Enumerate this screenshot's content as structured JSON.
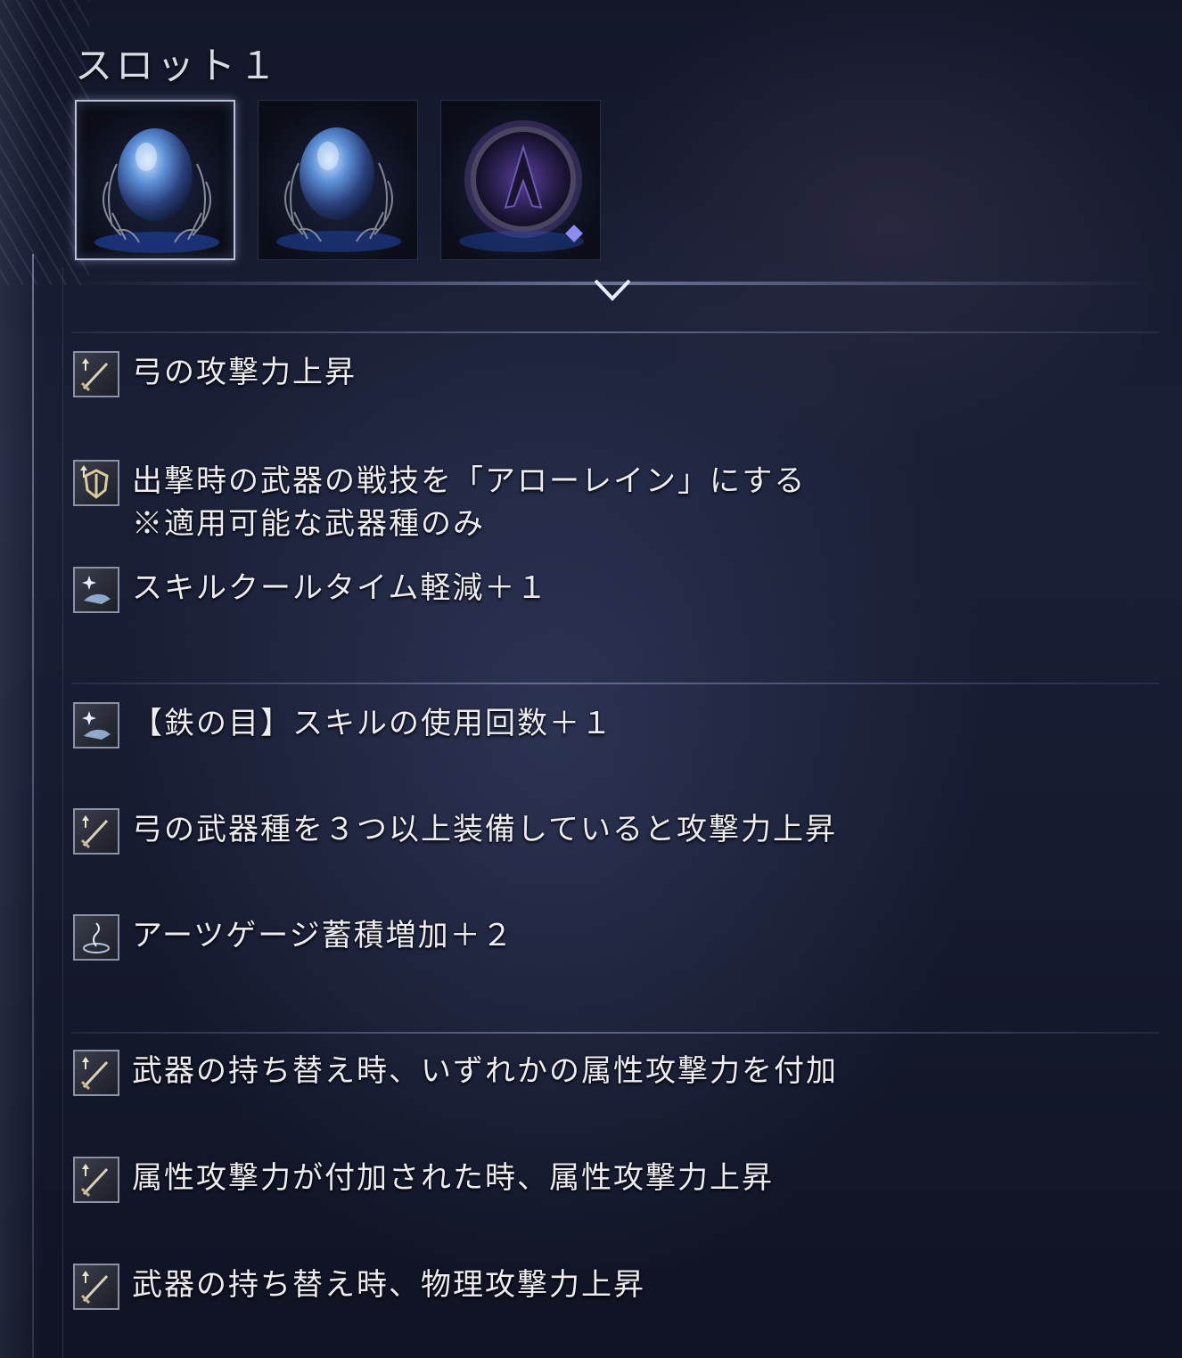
{
  "slot": {
    "title": "スロット１"
  },
  "relics": [
    {
      "icon": "blue-egg-relic-icon",
      "selected": true
    },
    {
      "icon": "blue-egg-relic-icon",
      "selected": false
    },
    {
      "icon": "purple-dark-relic-icon",
      "selected": false
    }
  ],
  "effects": [
    {
      "icon": "sword-up-icon",
      "line1": "弓の攻撃力上昇",
      "line2": ""
    },
    {
      "icon": "shield-up-icon",
      "line1": "出撃時の武器の戦技を「アローレイン」にする",
      "line2": "※適用可能な武器種のみ"
    },
    {
      "icon": "hand-sparkle-icon",
      "line1": "スキルクールタイム軽減＋１",
      "line2": ""
    },
    {
      "icon": "hand-sparkle-icon",
      "line1": "【鉄の目】スキルの使用回数＋１",
      "line2": ""
    },
    {
      "icon": "sword-up-icon",
      "line1": "弓の武器種を３つ以上装備していると攻撃力上昇",
      "line2": ""
    },
    {
      "icon": "swirl-icon",
      "line1": "アーツゲージ蓄積増加＋２",
      "line2": ""
    },
    {
      "icon": "sword-up-icon",
      "line1": "武器の持ち替え時、いずれかの属性攻撃力を付加",
      "line2": ""
    },
    {
      "icon": "sword-up-icon",
      "line1": "属性攻撃力が付加された時、属性攻撃力上昇",
      "line2": ""
    },
    {
      "icon": "sword-up-icon",
      "line1": "武器の持ち替え時、物理攻撃力上昇",
      "line2": ""
    }
  ],
  "colors": {
    "background": "#171b30",
    "text": "#ececf2",
    "accent": "#b9c0d8"
  }
}
